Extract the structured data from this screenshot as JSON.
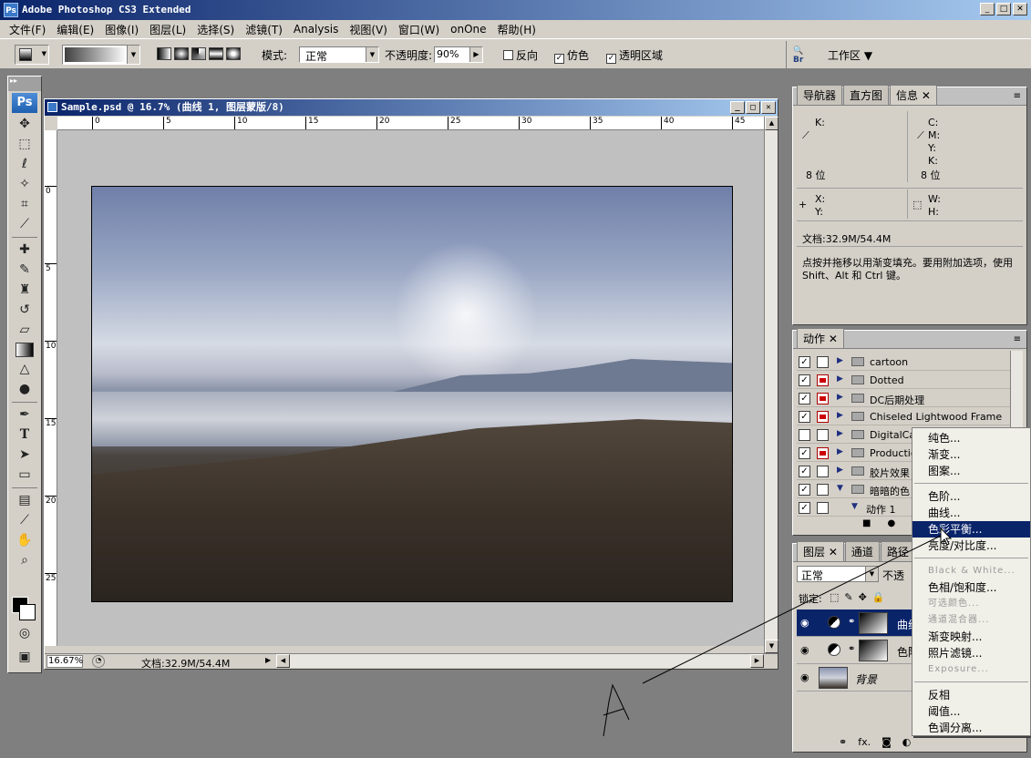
{
  "window": {
    "title": "Adobe Photoshop CS3 Extended",
    "logo": "Ps"
  },
  "menu": [
    "文件(F)",
    "编辑(E)",
    "图像(I)",
    "图层(L)",
    "选择(S)",
    "滤镜(T)",
    "Analysis",
    "视图(V)",
    "窗口(W)",
    "onOne",
    "帮助(H)"
  ],
  "options": {
    "mode_label": "模式:",
    "mode_value": "正常",
    "opacity_label": "不透明度:",
    "opacity_value": "90%",
    "reverse_label": "反向",
    "dither_label": "仿色",
    "transparency_label": "透明区域",
    "workspace_label": "工作区 ▼",
    "bridge_label": "Br"
  },
  "toolbox": {
    "badge": "Ps"
  },
  "document": {
    "title": "Sample.psd @ 16.7% (曲线 1, 图层蒙版/8)",
    "ruler_h": [
      "0",
      "5",
      "10",
      "15",
      "20",
      "25",
      "30",
      "35",
      "40",
      "45"
    ],
    "ruler_v": [
      "0",
      "5",
      "10",
      "15",
      "20",
      "25"
    ],
    "zoom": "16.67%",
    "doc_info": "文档:32.9M/54.4M"
  },
  "info_panel": {
    "tabs": [
      "导航器",
      "直方图",
      "信息"
    ],
    "k_label": "K:",
    "c_label": "C:",
    "m_label": "M:",
    "y_label": "Y:",
    "k2_label": "K:",
    "bits_left": "8 位",
    "bits_right": "8 位",
    "x_label": "X:",
    "y2_label": "Y:",
    "w_label": "W:",
    "h_label": "H:",
    "doc_size": "文档:32.9M/54.4M",
    "hint": "点按并拖移以用渐变填充。要用附加选项，使用 Shift、Alt 和 Ctrl 键。"
  },
  "actions_panel": {
    "tab": "动作",
    "rows": [
      {
        "name": "cartoon",
        "checked": "✓",
        "dialog": false,
        "expanded": "▶"
      },
      {
        "name": "Dotted",
        "checked": "✓",
        "dialog": true,
        "expanded": "▶"
      },
      {
        "name": "DC后期处理",
        "checked": "✓",
        "dialog": true,
        "expanded": "▶"
      },
      {
        "name": "Chiseled Lightwood Frame",
        "checked": "✓",
        "dialog": true,
        "expanded": "▶"
      },
      {
        "name": "DigitalCa",
        "checked": "",
        "dialog": false,
        "expanded": "▶"
      },
      {
        "name": "Production",
        "checked": "✓",
        "dialog": true,
        "expanded": "▶"
      },
      {
        "name": "胶片效果",
        "checked": "✓",
        "dialog": false,
        "expanded": "▶"
      },
      {
        "name": "暗暗的色",
        "checked": "✓",
        "dialog": false,
        "expanded": "▼"
      },
      {
        "name": "动作 1",
        "checked": "✓",
        "dialog": false,
        "expanded": "▼"
      }
    ]
  },
  "layers_panel": {
    "tabs": [
      "图层",
      "通道",
      "路径"
    ],
    "blend_mode": "正常",
    "opacity_label": "不透",
    "lock_label": "锁定:",
    "layers": [
      {
        "name": "曲线",
        "selected": true
      },
      {
        "name": "色阶",
        "selected": false
      },
      {
        "name": "背景",
        "selected": false
      }
    ],
    "fx_label": "fx."
  },
  "context_menu": {
    "items": [
      {
        "label": "纯色...",
        "disabled": false
      },
      {
        "label": "渐变...",
        "disabled": false
      },
      {
        "label": "图案...",
        "disabled": false
      },
      {
        "sep": true
      },
      {
        "label": "色阶...",
        "disabled": false
      },
      {
        "label": "曲线...",
        "disabled": false
      },
      {
        "label": "色彩平衡...",
        "disabled": false,
        "highlighted": true
      },
      {
        "label": "亮度/对比度...",
        "disabled": false
      },
      {
        "sep": true
      },
      {
        "label": "Black & White...",
        "disabled": true
      },
      {
        "label": "色相/饱和度...",
        "disabled": false
      },
      {
        "label": "可选颜色...",
        "disabled": true
      },
      {
        "label": "通道混合器...",
        "disabled": true
      },
      {
        "label": "渐变映射...",
        "disabled": false
      },
      {
        "label": "照片滤镜...",
        "disabled": false
      },
      {
        "label": "Exposure...",
        "disabled": true
      },
      {
        "sep": true
      },
      {
        "label": "反相",
        "disabled": false
      },
      {
        "label": "阈值...",
        "disabled": false
      },
      {
        "label": "色调分离...",
        "disabled": false
      }
    ]
  },
  "colors": {
    "titlebar": "#0a246a",
    "chrome": "#d4d0c8",
    "workspace": "#7f7f7f",
    "highlight": "#0a246a"
  }
}
